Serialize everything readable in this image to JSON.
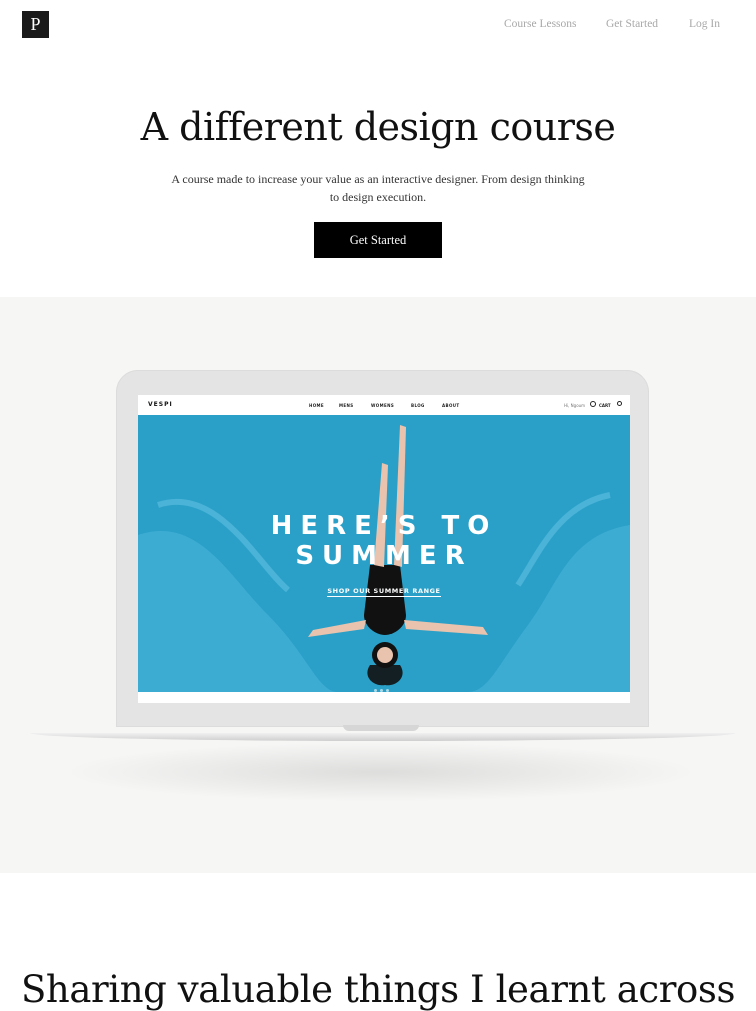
{
  "nav": {
    "logo_letter": "P",
    "links": [
      "Course Lessons",
      "Get Started",
      "Log In"
    ]
  },
  "hero": {
    "title": "A different design course",
    "subtitle": "A course made to increase your value as an interactive designer. From design thinking to design execution.",
    "cta_label": "Get Started"
  },
  "mockup": {
    "site_logo": "VESPI",
    "menu": [
      "HOME",
      "MENS",
      "WOMENS",
      "BLOG",
      "ABOUT"
    ],
    "greeting": "Hi, Ngoum",
    "cart_label": "CART",
    "banner_line1": "HERE’S TO",
    "banner_line2": "SUMMER",
    "banner_link": "SHOP OUR SUMMER RANGE",
    "pool_color": "#2aa0c8"
  },
  "section2": {
    "title": "Sharing valuable things I learnt across"
  },
  "colors": {
    "accent": "#000000",
    "band_bg": "#f6f6f5",
    "nav_link": "#a8a8a8"
  }
}
